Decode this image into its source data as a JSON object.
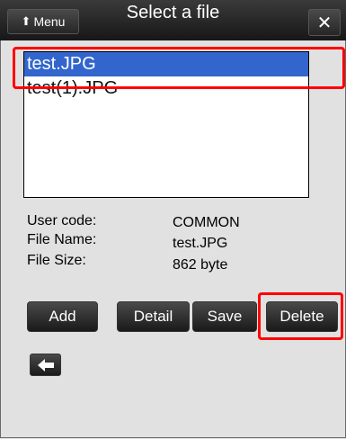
{
  "header": {
    "menu_label": "Menu",
    "title": "Select a file",
    "close_symbol": "✕"
  },
  "file_list": {
    "items": [
      {
        "name": "test.JPG",
        "selected": true
      },
      {
        "name": "test(1).JPG",
        "selected": false
      }
    ]
  },
  "info": {
    "user_code_label": "User code:",
    "user_code_value": "COMMON",
    "file_name_label": "File Name:",
    "file_name_value": "test.JPG",
    "file_size_label": "File Size:",
    "file_size_value": "862 byte"
  },
  "buttons": {
    "add": "Add",
    "detail": "Detail",
    "save": "Save",
    "delete": "Delete"
  },
  "icons": {
    "menu": "arrow-up-icon",
    "close": "close-icon",
    "back": "arrow-left-icon"
  },
  "colors": {
    "selection": "#3366cc",
    "highlight": "#ff0000",
    "titlebar": "#1f1f1f"
  }
}
